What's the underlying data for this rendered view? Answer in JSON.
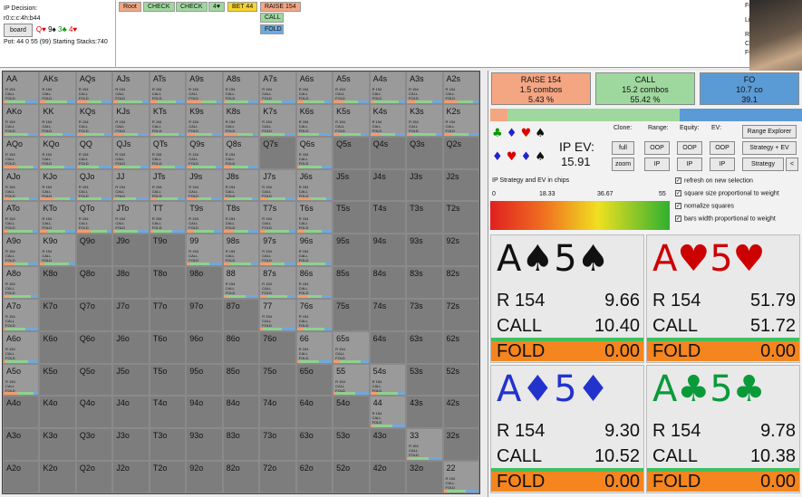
{
  "header": {
    "ip_decision": "IP Decision:",
    "board_text": "r0:c:c:4h:b44",
    "board_button": "board",
    "board_cards": [
      {
        "text": "Q♥",
        "color": "#d00"
      },
      {
        "text": "9♠",
        "color": "#000"
      },
      {
        "text": "3♣",
        "color": "#090"
      },
      {
        "text": "4♥",
        "color": "#d00"
      }
    ],
    "pot": "Pot: 44 0 55 (99) Starting Stacks:740",
    "crumbs": [
      {
        "label": "Root",
        "color": "#f4a582"
      },
      {
        "label": "CHECK",
        "color": "#9fd89f"
      },
      {
        "label": "CHECK",
        "color": "#9fd89f"
      },
      {
        "label": "4♥",
        "color": "#9fd89f"
      },
      {
        "label": "BET 44",
        "color": "#f6d32d"
      },
      {
        "label": "RAISE 154",
        "color": "#f4a582"
      }
    ],
    "sub_actions": [
      {
        "label": "CALL",
        "color": "#9fd89f"
      },
      {
        "label": "FOLD",
        "color": "#6fa8dc"
      }
    ],
    "right_labels": [
      "Frequenc",
      "Line:",
      "RAISE 15",
      "CALL",
      "FOLD"
    ]
  },
  "actions": [
    {
      "name": "RAISE 154",
      "combos": "1.5 combos",
      "pct": "5.43 %",
      "color": "#f4a582"
    },
    {
      "name": "CALL",
      "combos": "15.2 combos",
      "pct": "55.42 %",
      "color": "#9fd89f"
    },
    {
      "name": "FO",
      "combos": "10.7 co",
      "pct": "39.1",
      "color": "#5b9bd5"
    }
  ],
  "controls": {
    "clone": "Clone:",
    "range": "Range:",
    "equity": "Equity:",
    "ev": "EV:",
    "full": "full",
    "zoom": "zoom",
    "oop": "OOP",
    "ip": "IP",
    "range_explorer": "Range Explorer",
    "strategy_ev": "Strategy + EV",
    "strategy": "Strategy",
    "back": "<",
    "ip_ev_label": "IP EV:",
    "ip_ev_value": "15.91"
  },
  "legend": {
    "title": "IP Strategy and EV in chips",
    "ticks": [
      "0",
      "18.33",
      "36.67",
      "55"
    ]
  },
  "checks": [
    {
      "label": "refresh on new selection",
      "checked": true
    },
    {
      "label": "square size proportional to weight",
      "checked": true
    },
    {
      "label": "nomalize squares",
      "checked": true
    },
    {
      "label": "bars width proportional to weight",
      "checked": true
    }
  ],
  "cards": [
    {
      "hand": "A♠5♠",
      "color": "#111",
      "r": "R 154",
      "r_val": "9.66",
      "c": "CALL",
      "c_val": "10.40",
      "f": "FOLD",
      "f_val": "0.00"
    },
    {
      "hand": "A♥5♥",
      "color": "#c00",
      "r": "R 154",
      "r_val": "51.79",
      "c": "CALL",
      "c_val": "51.72",
      "f": "FOLD",
      "f_val": "0.00"
    },
    {
      "hand": "A♦5♦",
      "color": "#2233cc",
      "r": "R 154",
      "r_val": "9.30",
      "c": "CALL",
      "c_val": "10.52",
      "f": "FOLD",
      "f_val": "0.00"
    },
    {
      "hand": "A♣5♣",
      "color": "#0a9a3a",
      "r": "R 154",
      "r_val": "9.78",
      "c": "CALL",
      "c_val": "10.38",
      "f": "FOLD",
      "f_val": "0.00"
    }
  ],
  "grid": {
    "rows": [
      [
        "AA",
        "AKs",
        "AQs",
        "AJs",
        "ATs",
        "A9s",
        "A8s",
        "A7s",
        "A6s",
        "A5s",
        "A4s",
        "A3s",
        "A2s"
      ],
      [
        "AKo",
        "KK",
        "KQs",
        "KJs",
        "KTs",
        "K9s",
        "K8s",
        "K7s",
        "K6s",
        "K5s",
        "K4s",
        "K3s",
        "K2s"
      ],
      [
        "AQo",
        "KQo",
        "QQ",
        "QJs",
        "QTs",
        "Q9s",
        "Q8s",
        "Q7s",
        "Q6s",
        "Q5s",
        "Q4s",
        "Q3s",
        "Q2s"
      ],
      [
        "AJo",
        "KJo",
        "QJo",
        "JJ",
        "JTs",
        "J9s",
        "J8s",
        "J7s",
        "J6s",
        "J5s",
        "J4s",
        "J3s",
        "J2s"
      ],
      [
        "ATo",
        "KTo",
        "QTo",
        "JTo",
        "TT",
        "T9s",
        "T8s",
        "T7s",
        "T6s",
        "T5s",
        "T4s",
        "T3s",
        "T2s"
      ],
      [
        "A9o",
        "K9o",
        "Q9o",
        "J9o",
        "T9o",
        "99",
        "98s",
        "97s",
        "96s",
        "95s",
        "94s",
        "93s",
        "92s"
      ],
      [
        "A8o",
        "K8o",
        "Q8o",
        "J8o",
        "T8o",
        "98o",
        "88",
        "87s",
        "86s",
        "85s",
        "84s",
        "83s",
        "82s"
      ],
      [
        "A7o",
        "K7o",
        "Q7o",
        "J7o",
        "T7o",
        "97o",
        "87o",
        "77",
        "76s",
        "75s",
        "74s",
        "73s",
        "72s"
      ],
      [
        "A6o",
        "K6o",
        "Q6o",
        "J6o",
        "T6o",
        "96o",
        "86o",
        "76o",
        "66",
        "65s",
        "64s",
        "63s",
        "62s"
      ],
      [
        "A5o",
        "K5o",
        "Q5o",
        "J5o",
        "T5o",
        "95o",
        "85o",
        "75o",
        "65o",
        "55",
        "54s",
        "53s",
        "52s"
      ],
      [
        "A4o",
        "K4o",
        "Q4o",
        "J4o",
        "T4o",
        "94o",
        "84o",
        "74o",
        "64o",
        "54o",
        "44",
        "43s",
        "42s"
      ],
      [
        "A3o",
        "K3o",
        "Q3o",
        "J3o",
        "T3o",
        "93o",
        "83o",
        "73o",
        "63o",
        "53o",
        "43o",
        "33",
        "32s"
      ],
      [
        "A2o",
        "K2o",
        "Q2o",
        "J2o",
        "T2o",
        "92o",
        "82o",
        "72o",
        "62o",
        "52o",
        "42o",
        "32o",
        "22"
      ]
    ],
    "active": [
      "AA",
      "AKs",
      "AQs",
      "AJs",
      "ATs",
      "A9s",
      "A8s",
      "A7s",
      "A6s",
      "A5s",
      "A4s",
      "A3s",
      "A2s",
      "AKo",
      "KK",
      "KQs",
      "KJs",
      "KTs",
      "K9s",
      "K8s",
      "K7s",
      "K6s",
      "K5s",
      "K4s",
      "K3s",
      "K2s",
      "AQo",
      "KQo",
      "QQ",
      "QJs",
      "QTs",
      "Q9s",
      "Q8s",
      "Q6s",
      "AJo",
      "KJo",
      "QJo",
      "JJ",
      "JTs",
      "J9s",
      "J8s",
      "J7s",
      "J6s",
      "ATo",
      "KTo",
      "QTo",
      "JTo",
      "TT",
      "T9s",
      "T8s",
      "T7s",
      "T6s",
      "A9o",
      "K9o",
      "99",
      "98s",
      "97s",
      "96s",
      "A8o",
      "88",
      "87s",
      "86s",
      "A7o",
      "77",
      "76s",
      "A6o",
      "66",
      "65s",
      "A5o",
      "55",
      "54s",
      "44",
      "33",
      "22"
    ],
    "line_labels": [
      "R 154",
      "CALL",
      "FOLD"
    ]
  }
}
